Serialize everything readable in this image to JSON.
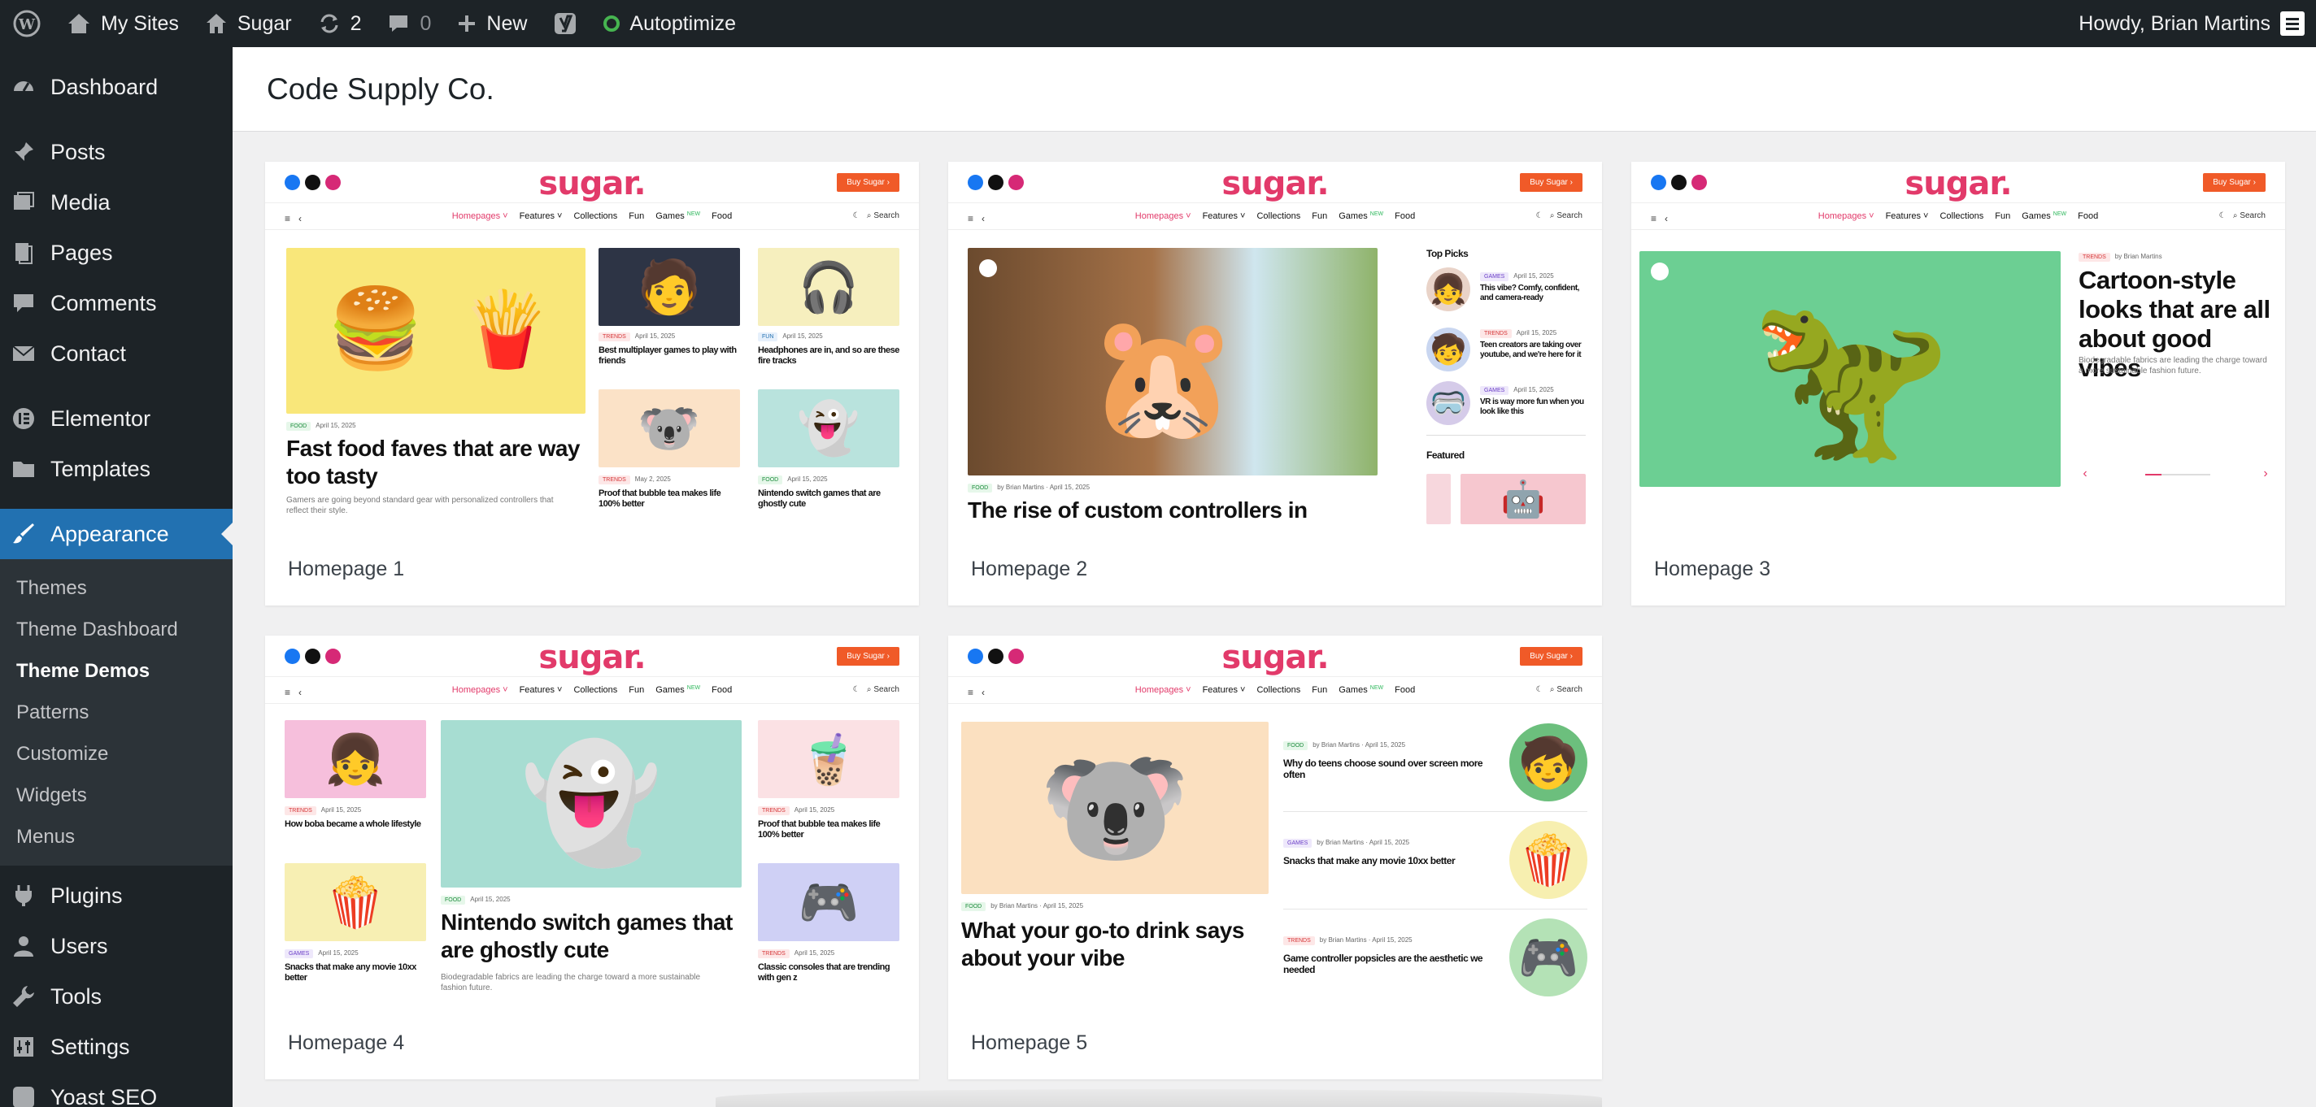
{
  "adminbar": {
    "my_sites": "My Sites",
    "site_name": "Sugar",
    "updates_count": "2",
    "comments_count": "0",
    "new_label": "New",
    "autoptimize": "Autoptimize",
    "howdy": "Howdy, Brian Martins"
  },
  "sidebar": {
    "dashboard": "Dashboard",
    "posts": "Posts",
    "media": "Media",
    "pages": "Pages",
    "comments": "Comments",
    "contact": "Contact",
    "elementor": "Elementor",
    "templates": "Templates",
    "appearance": "Appearance",
    "sub": [
      "Themes",
      "Theme Dashboard",
      "Theme Demos",
      "Patterns",
      "Customize",
      "Widgets",
      "Menus"
    ],
    "plugins": "Plugins",
    "users": "Users",
    "tools": "Tools",
    "settings": "Settings",
    "yoast": "Yoast SEO"
  },
  "header": {
    "title": "Code Supply Co."
  },
  "site": {
    "logo": "sugar.",
    "buy": "Buy Sugar ›",
    "nav": [
      "Homepages ˅",
      "Features ˅",
      "Collections",
      "Fun",
      "Games",
      "Food"
    ],
    "new_badge": "NEW",
    "search": "Search"
  },
  "demos": {
    "labels": [
      "Homepage 1",
      "Homepage 2",
      "Homepage 3",
      "Homepage 4",
      "Homepage 5"
    ],
    "tags": {
      "food": "FOOD",
      "trends": "TRENDS",
      "fun": "FUN",
      "games": "GAMES"
    },
    "dates": {
      "april": "April 15, 2025",
      "may": "May 2, 2025"
    },
    "by_author": "by Brian Martins",
    "h1": {
      "main_title": "Fast food faves that are way too tasty",
      "main_desc": "Gamers are going beyond standard gear with personalized controllers that reflect their style.",
      "t1": "Best multiplayer games to play with friends",
      "t2": "Headphones are in, and so are these fire tracks",
      "t3": "Proof that bubble tea makes life 100% better",
      "t4": "Nintendo switch games that are ghostly cute"
    },
    "h2": {
      "main_title": "The rise of custom controllers in",
      "top_picks": "Top Picks",
      "featured": "Featured",
      "p1": "This vibe? Comfy, confident, and camera-ready",
      "p2": "Teen creators are taking over youtube, and we're here for it",
      "p3": "VR is way more fun when you look like this"
    },
    "h3": {
      "main_title": "Cartoon-style looks that are all about good vibes",
      "main_desc": "Biodegradable fabrics are leading the charge toward a more sustainable fashion future."
    },
    "h4": {
      "t1": "How boba became a whole lifestyle",
      "t2": "Snacks that make any movie 10xx better",
      "main_title": "Nintendo switch games that are ghostly cute",
      "main_desc": "Biodegradable fabrics are leading the charge toward a more sustainable fashion future.",
      "t3": "Proof that bubble tea makes life 100% better",
      "t4": "Classic consoles that are trending with gen z"
    },
    "h5": {
      "main_title": "What your go-to drink says about your vibe",
      "r1": "Why do teens choose sound over screen more often",
      "r2": "Snacks that make any movie 10xx better",
      "r3": "Game controller popsicles are the aesthetic we needed"
    }
  },
  "colors": {
    "accent": "#2271b1",
    "adminbar": "#1d2327",
    "brand": "#e23a6a",
    "buy": "#f05a28"
  }
}
